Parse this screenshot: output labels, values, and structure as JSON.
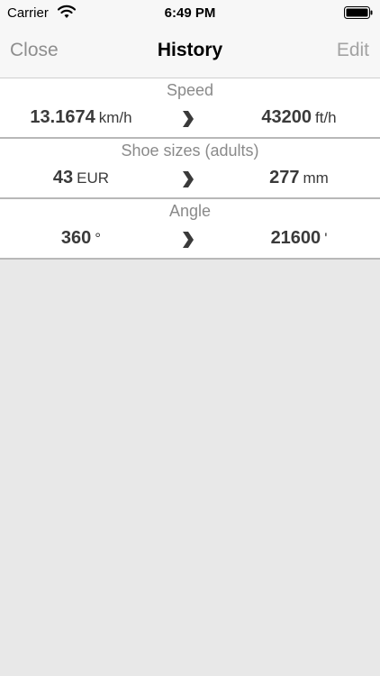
{
  "status_bar": {
    "carrier": "Carrier",
    "time": "6:49 PM"
  },
  "nav": {
    "close_label": "Close",
    "title": "History",
    "edit_label": "Edit"
  },
  "history": [
    {
      "category": "Speed",
      "from_value": "13.1674",
      "from_unit": "km/h",
      "to_value": "43200",
      "to_unit": "ft/h"
    },
    {
      "category": "Shoe sizes (adults)",
      "from_value": "43",
      "from_unit": "EUR",
      "to_value": "277",
      "to_unit": "mm"
    },
    {
      "category": "Angle",
      "from_value": "360",
      "from_unit": "°",
      "to_value": "21600",
      "to_unit": "'"
    }
  ],
  "icons": {
    "wifi": "wifi-icon",
    "battery": "battery-icon",
    "arrow": "chevron-right-icon"
  },
  "colors": {
    "nav_background": "#f7f7f7",
    "background": "#e8e8e8",
    "inactive_button": "#8e8e8e"
  }
}
